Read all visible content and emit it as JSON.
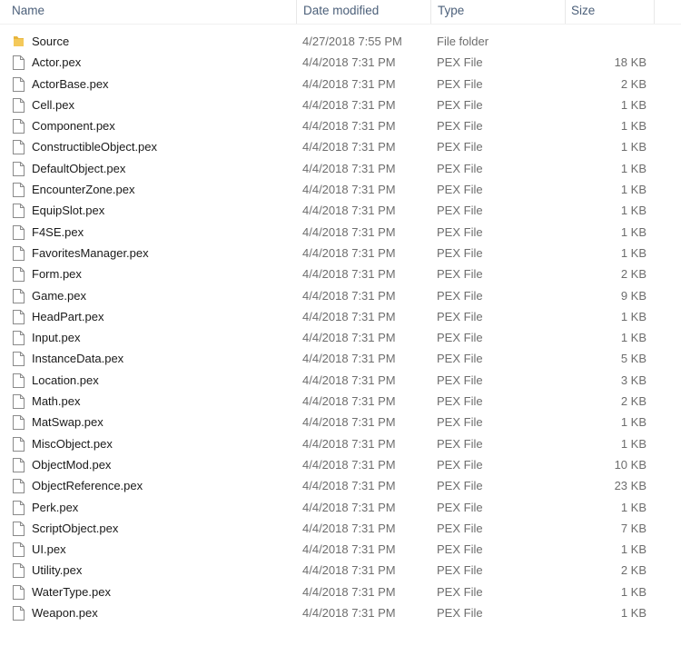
{
  "columns": {
    "name": "Name",
    "date": "Date modified",
    "type": "Type",
    "size": "Size"
  },
  "items": [
    {
      "name": "Source",
      "date": "4/27/2018 7:55 PM",
      "type": "File folder",
      "size": "",
      "icon": "folder-icon"
    },
    {
      "name": "Actor.pex",
      "date": "4/4/2018 7:31 PM",
      "type": "PEX File",
      "size": "18 KB",
      "icon": "file-icon"
    },
    {
      "name": "ActorBase.pex",
      "date": "4/4/2018 7:31 PM",
      "type": "PEX File",
      "size": "2 KB",
      "icon": "file-icon"
    },
    {
      "name": "Cell.pex",
      "date": "4/4/2018 7:31 PM",
      "type": "PEX File",
      "size": "1 KB",
      "icon": "file-icon"
    },
    {
      "name": "Component.pex",
      "date": "4/4/2018 7:31 PM",
      "type": "PEX File",
      "size": "1 KB",
      "icon": "file-icon"
    },
    {
      "name": "ConstructibleObject.pex",
      "date": "4/4/2018 7:31 PM",
      "type": "PEX File",
      "size": "1 KB",
      "icon": "file-icon"
    },
    {
      "name": "DefaultObject.pex",
      "date": "4/4/2018 7:31 PM",
      "type": "PEX File",
      "size": "1 KB",
      "icon": "file-icon"
    },
    {
      "name": "EncounterZone.pex",
      "date": "4/4/2018 7:31 PM",
      "type": "PEX File",
      "size": "1 KB",
      "icon": "file-icon"
    },
    {
      "name": "EquipSlot.pex",
      "date": "4/4/2018 7:31 PM",
      "type": "PEX File",
      "size": "1 KB",
      "icon": "file-icon"
    },
    {
      "name": "F4SE.pex",
      "date": "4/4/2018 7:31 PM",
      "type": "PEX File",
      "size": "1 KB",
      "icon": "file-icon"
    },
    {
      "name": "FavoritesManager.pex",
      "date": "4/4/2018 7:31 PM",
      "type": "PEX File",
      "size": "1 KB",
      "icon": "file-icon"
    },
    {
      "name": "Form.pex",
      "date": "4/4/2018 7:31 PM",
      "type": "PEX File",
      "size": "2 KB",
      "icon": "file-icon"
    },
    {
      "name": "Game.pex",
      "date": "4/4/2018 7:31 PM",
      "type": "PEX File",
      "size": "9 KB",
      "icon": "file-icon"
    },
    {
      "name": "HeadPart.pex",
      "date": "4/4/2018 7:31 PM",
      "type": "PEX File",
      "size": "1 KB",
      "icon": "file-icon"
    },
    {
      "name": "Input.pex",
      "date": "4/4/2018 7:31 PM",
      "type": "PEX File",
      "size": "1 KB",
      "icon": "file-icon"
    },
    {
      "name": "InstanceData.pex",
      "date": "4/4/2018 7:31 PM",
      "type": "PEX File",
      "size": "5 KB",
      "icon": "file-icon"
    },
    {
      "name": "Location.pex",
      "date": "4/4/2018 7:31 PM",
      "type": "PEX File",
      "size": "3 KB",
      "icon": "file-icon"
    },
    {
      "name": "Math.pex",
      "date": "4/4/2018 7:31 PM",
      "type": "PEX File",
      "size": "2 KB",
      "icon": "file-icon"
    },
    {
      "name": "MatSwap.pex",
      "date": "4/4/2018 7:31 PM",
      "type": "PEX File",
      "size": "1 KB",
      "icon": "file-icon"
    },
    {
      "name": "MiscObject.pex",
      "date": "4/4/2018 7:31 PM",
      "type": "PEX File",
      "size": "1 KB",
      "icon": "file-icon"
    },
    {
      "name": "ObjectMod.pex",
      "date": "4/4/2018 7:31 PM",
      "type": "PEX File",
      "size": "10 KB",
      "icon": "file-icon"
    },
    {
      "name": "ObjectReference.pex",
      "date": "4/4/2018 7:31 PM",
      "type": "PEX File",
      "size": "23 KB",
      "icon": "file-icon"
    },
    {
      "name": "Perk.pex",
      "date": "4/4/2018 7:31 PM",
      "type": "PEX File",
      "size": "1 KB",
      "icon": "file-icon"
    },
    {
      "name": "ScriptObject.pex",
      "date": "4/4/2018 7:31 PM",
      "type": "PEX File",
      "size": "7 KB",
      "icon": "file-icon"
    },
    {
      "name": "UI.pex",
      "date": "4/4/2018 7:31 PM",
      "type": "PEX File",
      "size": "1 KB",
      "icon": "file-icon"
    },
    {
      "name": "Utility.pex",
      "date": "4/4/2018 7:31 PM",
      "type": "PEX File",
      "size": "2 KB",
      "icon": "file-icon"
    },
    {
      "name": "WaterType.pex",
      "date": "4/4/2018 7:31 PM",
      "type": "PEX File",
      "size": "1 KB",
      "icon": "file-icon"
    },
    {
      "name": "Weapon.pex",
      "date": "4/4/2018 7:31 PM",
      "type": "PEX File",
      "size": "1 KB",
      "icon": "file-icon"
    }
  ],
  "colors": {
    "header_text": "#4c607a",
    "name_text": "#1a1a1a",
    "detail_text": "#6d6d6d",
    "folder": "#e8b53c"
  }
}
